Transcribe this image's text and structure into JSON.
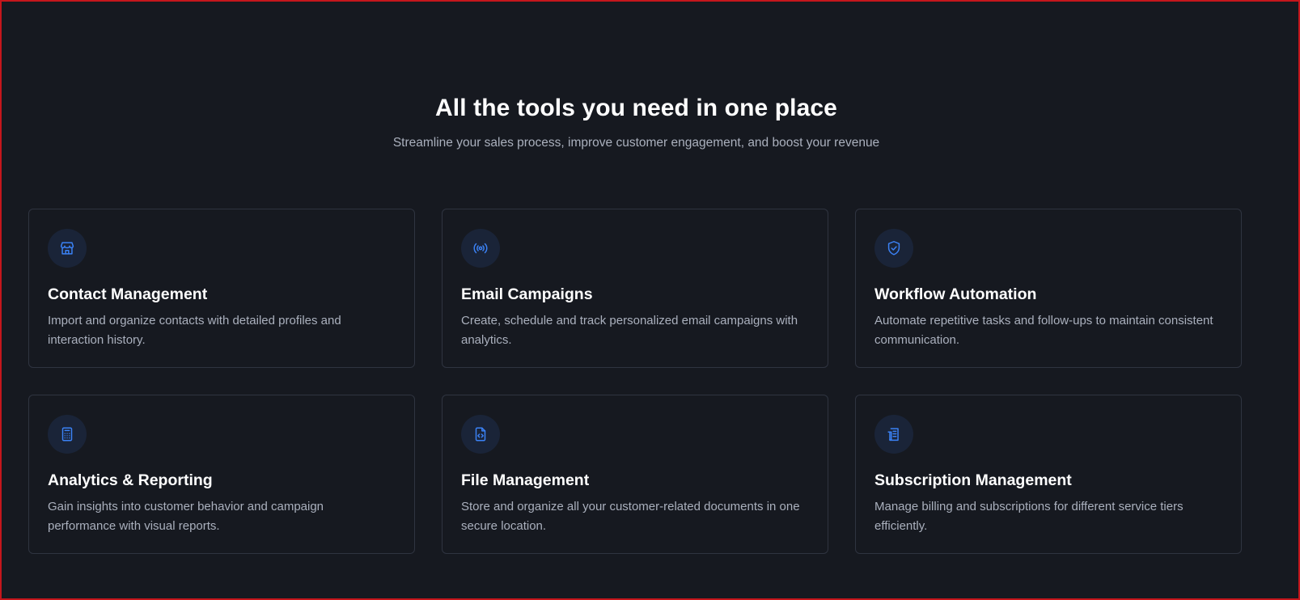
{
  "header": {
    "title": "All the tools you need in one place",
    "subtitle": "Streamline your sales process, improve customer engagement, and boost your revenue"
  },
  "colors": {
    "background": "#161920",
    "card_border": "#2f3440",
    "accent": "#3b82f6",
    "icon_circle": "#1a2438",
    "frame_border": "#c4161c"
  },
  "features": [
    {
      "icon": "store-icon",
      "title": "Contact Management",
      "description": "Import and organize contacts with detailed profiles and interaction history."
    },
    {
      "icon": "broadcast-icon",
      "title": "Email Campaigns",
      "description": "Create, schedule and track personalized email campaigns with analytics."
    },
    {
      "icon": "shield-check-icon",
      "title": "Workflow Automation",
      "description": "Automate repetitive tasks and follow-ups to maintain consistent communication."
    },
    {
      "icon": "calculator-icon",
      "title": "Analytics & Reporting",
      "description": "Gain insights into customer behavior and campaign performance with visual reports."
    },
    {
      "icon": "file-code-icon",
      "title": "File Management",
      "description": "Store and organize all your customer-related documents in one secure location."
    },
    {
      "icon": "receipt-icon",
      "title": "Subscription Management",
      "description": "Manage billing and subscriptions for different service tiers efficiently."
    }
  ]
}
